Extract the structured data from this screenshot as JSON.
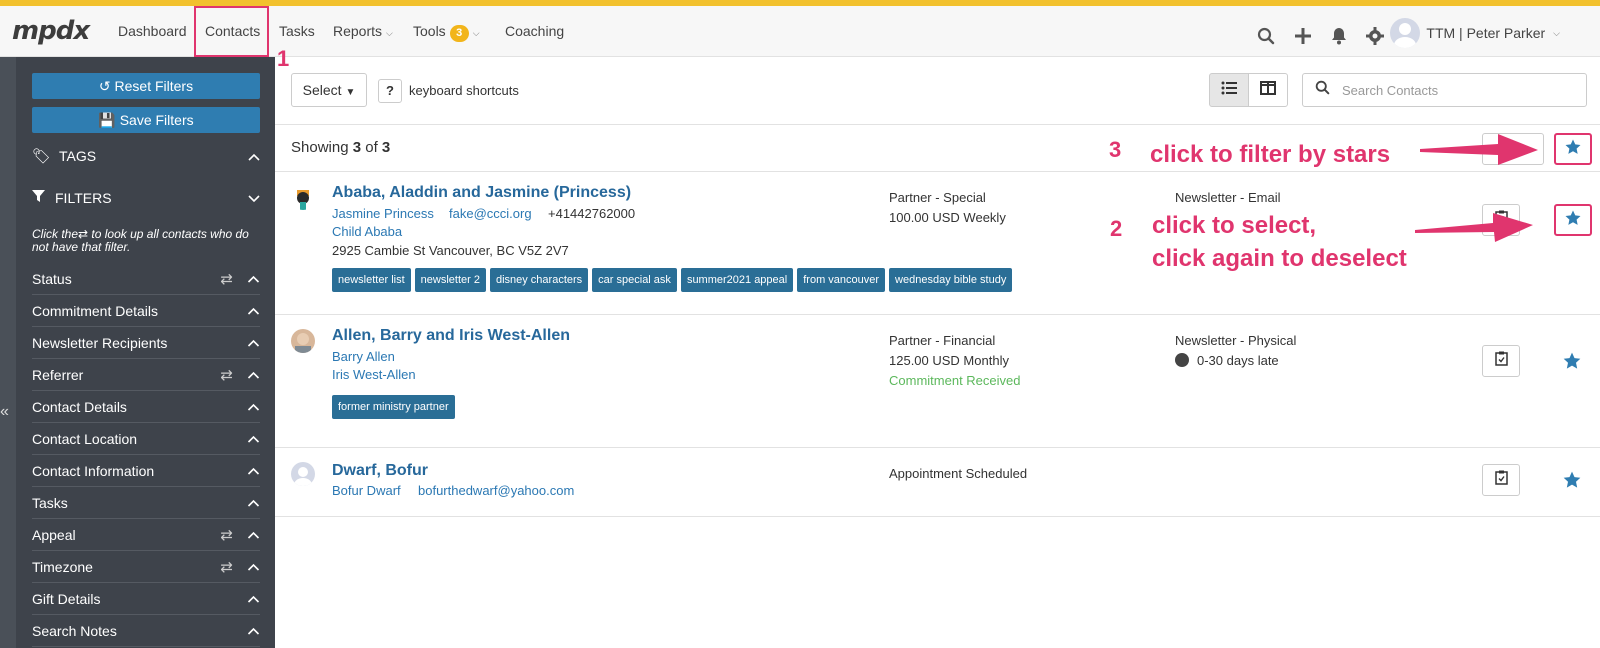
{
  "nav": {
    "logo": "mpdx",
    "items": [
      "Dashboard",
      "Contacts",
      "Tasks",
      "Reports",
      "Tools",
      "Coaching"
    ],
    "tools_badge": "3",
    "user_label": "TTM | Peter Parker"
  },
  "sidebar": {
    "reset_filters": "Reset Filters",
    "save_filters": "Save Filters",
    "tags_label": "TAGS",
    "filters_label": "FILTERS",
    "help_text_before": "Click the",
    "help_text_after": "to look up all contacts who do not have that filter.",
    "groups": [
      {
        "label": "Status",
        "reversible": true
      },
      {
        "label": "Commitment Details",
        "reversible": false
      },
      {
        "label": "Newsletter Recipients",
        "reversible": false
      },
      {
        "label": "Referrer",
        "reversible": true
      },
      {
        "label": "Contact Details",
        "reversible": false
      },
      {
        "label": "Contact Location",
        "reversible": false
      },
      {
        "label": "Contact Information",
        "reversible": false
      },
      {
        "label": "Tasks",
        "reversible": false
      },
      {
        "label": "Appeal",
        "reversible": true
      },
      {
        "label": "Timezone",
        "reversible": true
      },
      {
        "label": "Gift Details",
        "reversible": false
      },
      {
        "label": "Search Notes",
        "reversible": false
      }
    ]
  },
  "toolbar": {
    "select_label": "Select",
    "shortcut_key": "?",
    "shortcut_label": "keyboard shortcuts",
    "search_placeholder": "Search Contacts"
  },
  "list": {
    "showing_prefix": "Showing",
    "showing_count": "3",
    "showing_of": "of",
    "showing_total": "3"
  },
  "contacts": [
    {
      "name": "Ababa, Aladdin and Jasmine (Princess)",
      "primary_person": "Jasmine Princess",
      "email": "fake@ccci.org",
      "phone": "+41442762000",
      "secondary_person": "Child Ababa",
      "address": "2925 Cambie St Vancouver, BC V5Z 2V7",
      "status": "Partner - Special",
      "commitment": "100.00 USD Weekly",
      "newsletter": "Newsletter - Email",
      "tags": [
        "newsletter list",
        "newsletter 2",
        "disney characters",
        "car special ask",
        "summer2021 appeal",
        "from vancouver",
        "wednesday bible study"
      ]
    },
    {
      "name": "Allen, Barry and Iris West-Allen",
      "primary_person": "Barry Allen",
      "secondary_person": "Iris West-Allen",
      "status": "Partner - Financial",
      "commitment": "125.00 USD Monthly",
      "commitment_status": "Commitment Received",
      "newsletter": "Newsletter - Physical",
      "late_status": "0-30 days late",
      "tags": [
        "former ministry partner"
      ]
    },
    {
      "name": "Dwarf, Bofur",
      "primary_person": "Bofur Dwarf",
      "email": "bofurthedwarf@yahoo.com",
      "status": "Appointment Scheduled"
    }
  ],
  "annotations": {
    "n1": "1",
    "n2": "2",
    "n3": "3",
    "text3": "click to filter by stars",
    "text2_line1": "click to select,",
    "text2_line2": "click again to deselect"
  },
  "colors": {
    "accent_bar": "#f2c12e",
    "annotation": "#e0356e",
    "link_blue": "#27689b",
    "tag_blue": "#2a6e96",
    "star_blue": "#2f7db1",
    "sidebar_bg": "#3e434b"
  }
}
